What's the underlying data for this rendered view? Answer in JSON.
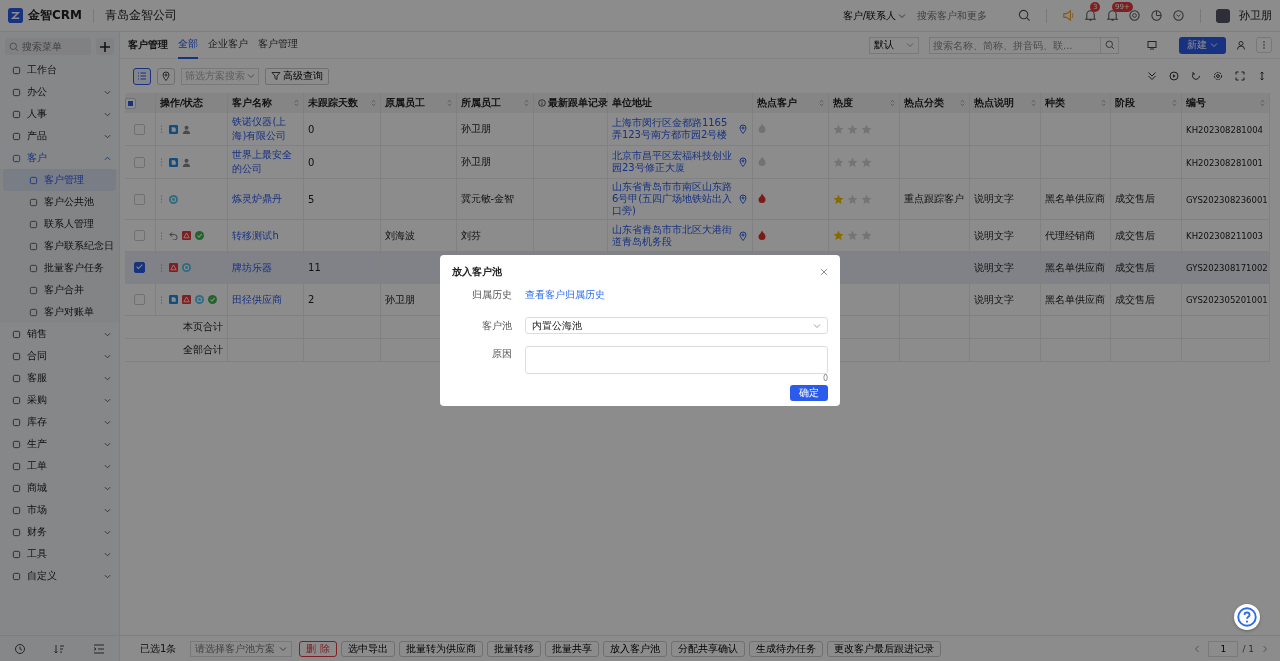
{
  "app": {
    "logo_text": "金智CRM",
    "company": "青岛金智公司"
  },
  "topbar": {
    "scope": "客户/联系人",
    "search_placeholder": "搜索客户和更多",
    "badges": [
      "3",
      "99+"
    ],
    "user": "孙卫朋"
  },
  "sidebar": {
    "search_placeholder": "搜索菜单",
    "items": [
      {
        "label": "工作台",
        "kind": "link",
        "selected": false
      },
      {
        "label": "办公",
        "kind": "group",
        "expanded": false,
        "selected": false
      },
      {
        "label": "人事",
        "kind": "group",
        "expanded": false,
        "selected": false
      },
      {
        "label": "产品",
        "kind": "group",
        "expanded": false,
        "selected": false
      },
      {
        "label": "客户",
        "kind": "group",
        "expanded": true,
        "selected": true,
        "children": [
          {
            "label": "客户管理",
            "selected": true
          },
          {
            "label": "客户公共池",
            "selected": false
          },
          {
            "label": "联系人管理",
            "selected": false
          },
          {
            "label": "客户联系纪念日",
            "selected": false
          },
          {
            "label": "批量客户任务",
            "selected": false
          },
          {
            "label": "客户合并",
            "selected": false
          },
          {
            "label": "客户对账单",
            "selected": false
          }
        ]
      },
      {
        "label": "销售",
        "kind": "group",
        "expanded": false,
        "selected": false
      },
      {
        "label": "合同",
        "kind": "group",
        "expanded": false,
        "selected": false
      },
      {
        "label": "客服",
        "kind": "group",
        "expanded": false,
        "selected": false
      },
      {
        "label": "采购",
        "kind": "group",
        "expanded": false,
        "selected": false
      },
      {
        "label": "库存",
        "kind": "group",
        "expanded": false,
        "selected": false
      },
      {
        "label": "生产",
        "kind": "group",
        "expanded": false,
        "selected": false
      },
      {
        "label": "工单",
        "kind": "group",
        "expanded": false,
        "selected": false
      },
      {
        "label": "商城",
        "kind": "group",
        "expanded": false,
        "selected": false
      },
      {
        "label": "市场",
        "kind": "group",
        "expanded": false,
        "selected": false
      },
      {
        "label": "财务",
        "kind": "group",
        "expanded": false,
        "selected": false
      },
      {
        "label": "工具",
        "kind": "group",
        "expanded": false,
        "selected": false
      },
      {
        "label": "自定义",
        "kind": "group",
        "expanded": false,
        "selected": false
      }
    ]
  },
  "page": {
    "title": "客户管理",
    "tabs": [
      {
        "label": "全部",
        "selected": true
      },
      {
        "label": "企业客户",
        "selected": false
      },
      {
        "label": "客户管理",
        "selected": false
      }
    ],
    "view_select": "默认",
    "search_placeholder": "搜索名称、简称、拼音码、联...",
    "new_button": "新建"
  },
  "toolbar": {
    "views": [
      {
        "kind": "list",
        "selected": true
      },
      {
        "kind": "map",
        "selected": false
      }
    ],
    "filter_placeholder": "筛选方案搜索",
    "advanced_button": "高级查询"
  },
  "table": {
    "indeterminate": true,
    "columns": [
      {
        "label": "操作/状态",
        "sortable": false
      },
      {
        "label": "客户名称",
        "sortable": true
      },
      {
        "label": "未跟踪天数",
        "sortable": true
      },
      {
        "label": "原属员工",
        "sortable": true
      },
      {
        "label": "所属员工",
        "sortable": true
      },
      {
        "label": "最新跟单记录",
        "sortable": false,
        "info": true
      },
      {
        "label": "单位地址",
        "sortable": false
      },
      {
        "label": "热点客户",
        "sortable": true
      },
      {
        "label": "热度",
        "sortable": true
      },
      {
        "label": "热点分类",
        "sortable": true
      },
      {
        "label": "热点说明",
        "sortable": true
      },
      {
        "label": "种类",
        "sortable": true
      },
      {
        "label": "阶段",
        "sortable": true
      },
      {
        "label": "编号",
        "sortable": true
      }
    ],
    "rows": [
      {
        "checked": false,
        "statuses": [
          {
            "kind": "doc"
          },
          {
            "kind": "user"
          }
        ],
        "name": "铁诺仪器(上海)有限公司",
        "days": "0",
        "staff": "孙卫朋",
        "address": "上海市闵行区金都路1165弄123号南方都市园2号楼",
        "hot": false,
        "stars": 0,
        "code": "KH202308281004"
      },
      {
        "checked": false,
        "statuses": [
          {
            "kind": "doc"
          },
          {
            "kind": "user"
          }
        ],
        "name": "世界上最安全的公司",
        "days": "0",
        "staff": "孙卫朋",
        "address": "北京市昌平区宏福科技创业园23号修正大厦",
        "hot": false,
        "stars": 0,
        "code": "KH202308281001"
      },
      {
        "checked": false,
        "statuses": [
          {
            "kind": "ring"
          }
        ],
        "name": "炼灵炉鼎丹",
        "days": "5",
        "staff": "冀元敏-金智",
        "address": "山东省青岛市市南区山东路6号甲(五四广场地铁站出入口旁)",
        "hot": true,
        "stars": 1,
        "category": "重点跟踪客户",
        "note": "说明文字",
        "type": "黑名单供应商",
        "stage": "成交售后",
        "code": "GYS202308236001"
      },
      {
        "checked": false,
        "statuses": [
          {
            "kind": "undo"
          },
          {
            "kind": "alert"
          },
          {
            "kind": "check"
          }
        ],
        "name": "转移测试h",
        "former": "刘海波",
        "staff": "刘芬",
        "address": "山东省青岛市市北区大港街道青岛机务段",
        "hot": true,
        "stars": 1,
        "note": "说明文字",
        "type": "代理经销商",
        "stage": "成交售后",
        "code": "KH202308211003"
      },
      {
        "checked": true,
        "statuses": [
          {
            "kind": "alert"
          },
          {
            "kind": "ring"
          }
        ],
        "name": "牌坊乐器",
        "days": "11",
        "note": "说明文字",
        "type": "黑名单供应商",
        "stage": "成交售后",
        "code": "GYS202308171002"
      },
      {
        "checked": false,
        "statuses": [
          {
            "kind": "doc"
          },
          {
            "kind": "alert"
          },
          {
            "kind": "ring"
          },
          {
            "kind": "check"
          }
        ],
        "name": "田径供应商",
        "days": "2",
        "former": "孙卫朋",
        "note": "说明文字",
        "type": "黑名单供应商",
        "stage": "成交售后",
        "code": "GYS202305201001"
      }
    ],
    "summary": [
      "本页合计",
      "全部合计"
    ]
  },
  "bottom_bar": {
    "selected_count": "已选1条",
    "pool_placeholder": "请选择客户池方案",
    "buttons": [
      {
        "label": "删 除",
        "kind": "danger"
      },
      {
        "label": "选中导出",
        "kind": "normal"
      },
      {
        "label": "批量转为供应商",
        "kind": "normal"
      },
      {
        "label": "批量转移",
        "kind": "normal"
      },
      {
        "label": "批量共享",
        "kind": "normal"
      },
      {
        "label": "放入客户池",
        "kind": "normal"
      },
      {
        "label": "分配共享确认",
        "kind": "normal"
      },
      {
        "label": "生成待办任务",
        "kind": "normal"
      },
      {
        "label": "更改客户最后跟进记录",
        "kind": "normal"
      }
    ],
    "page": "1",
    "total_pages": "/ 1"
  },
  "dialog": {
    "title": "放入客户池",
    "fields": [
      {
        "label": "归属历史",
        "kind": "link",
        "value": "查看客户归属历史"
      },
      {
        "label": "客户池",
        "kind": "select",
        "value": "内置公海池"
      },
      {
        "label": "原因",
        "kind": "textarea",
        "counter": "0"
      }
    ],
    "confirm": "确定"
  }
}
